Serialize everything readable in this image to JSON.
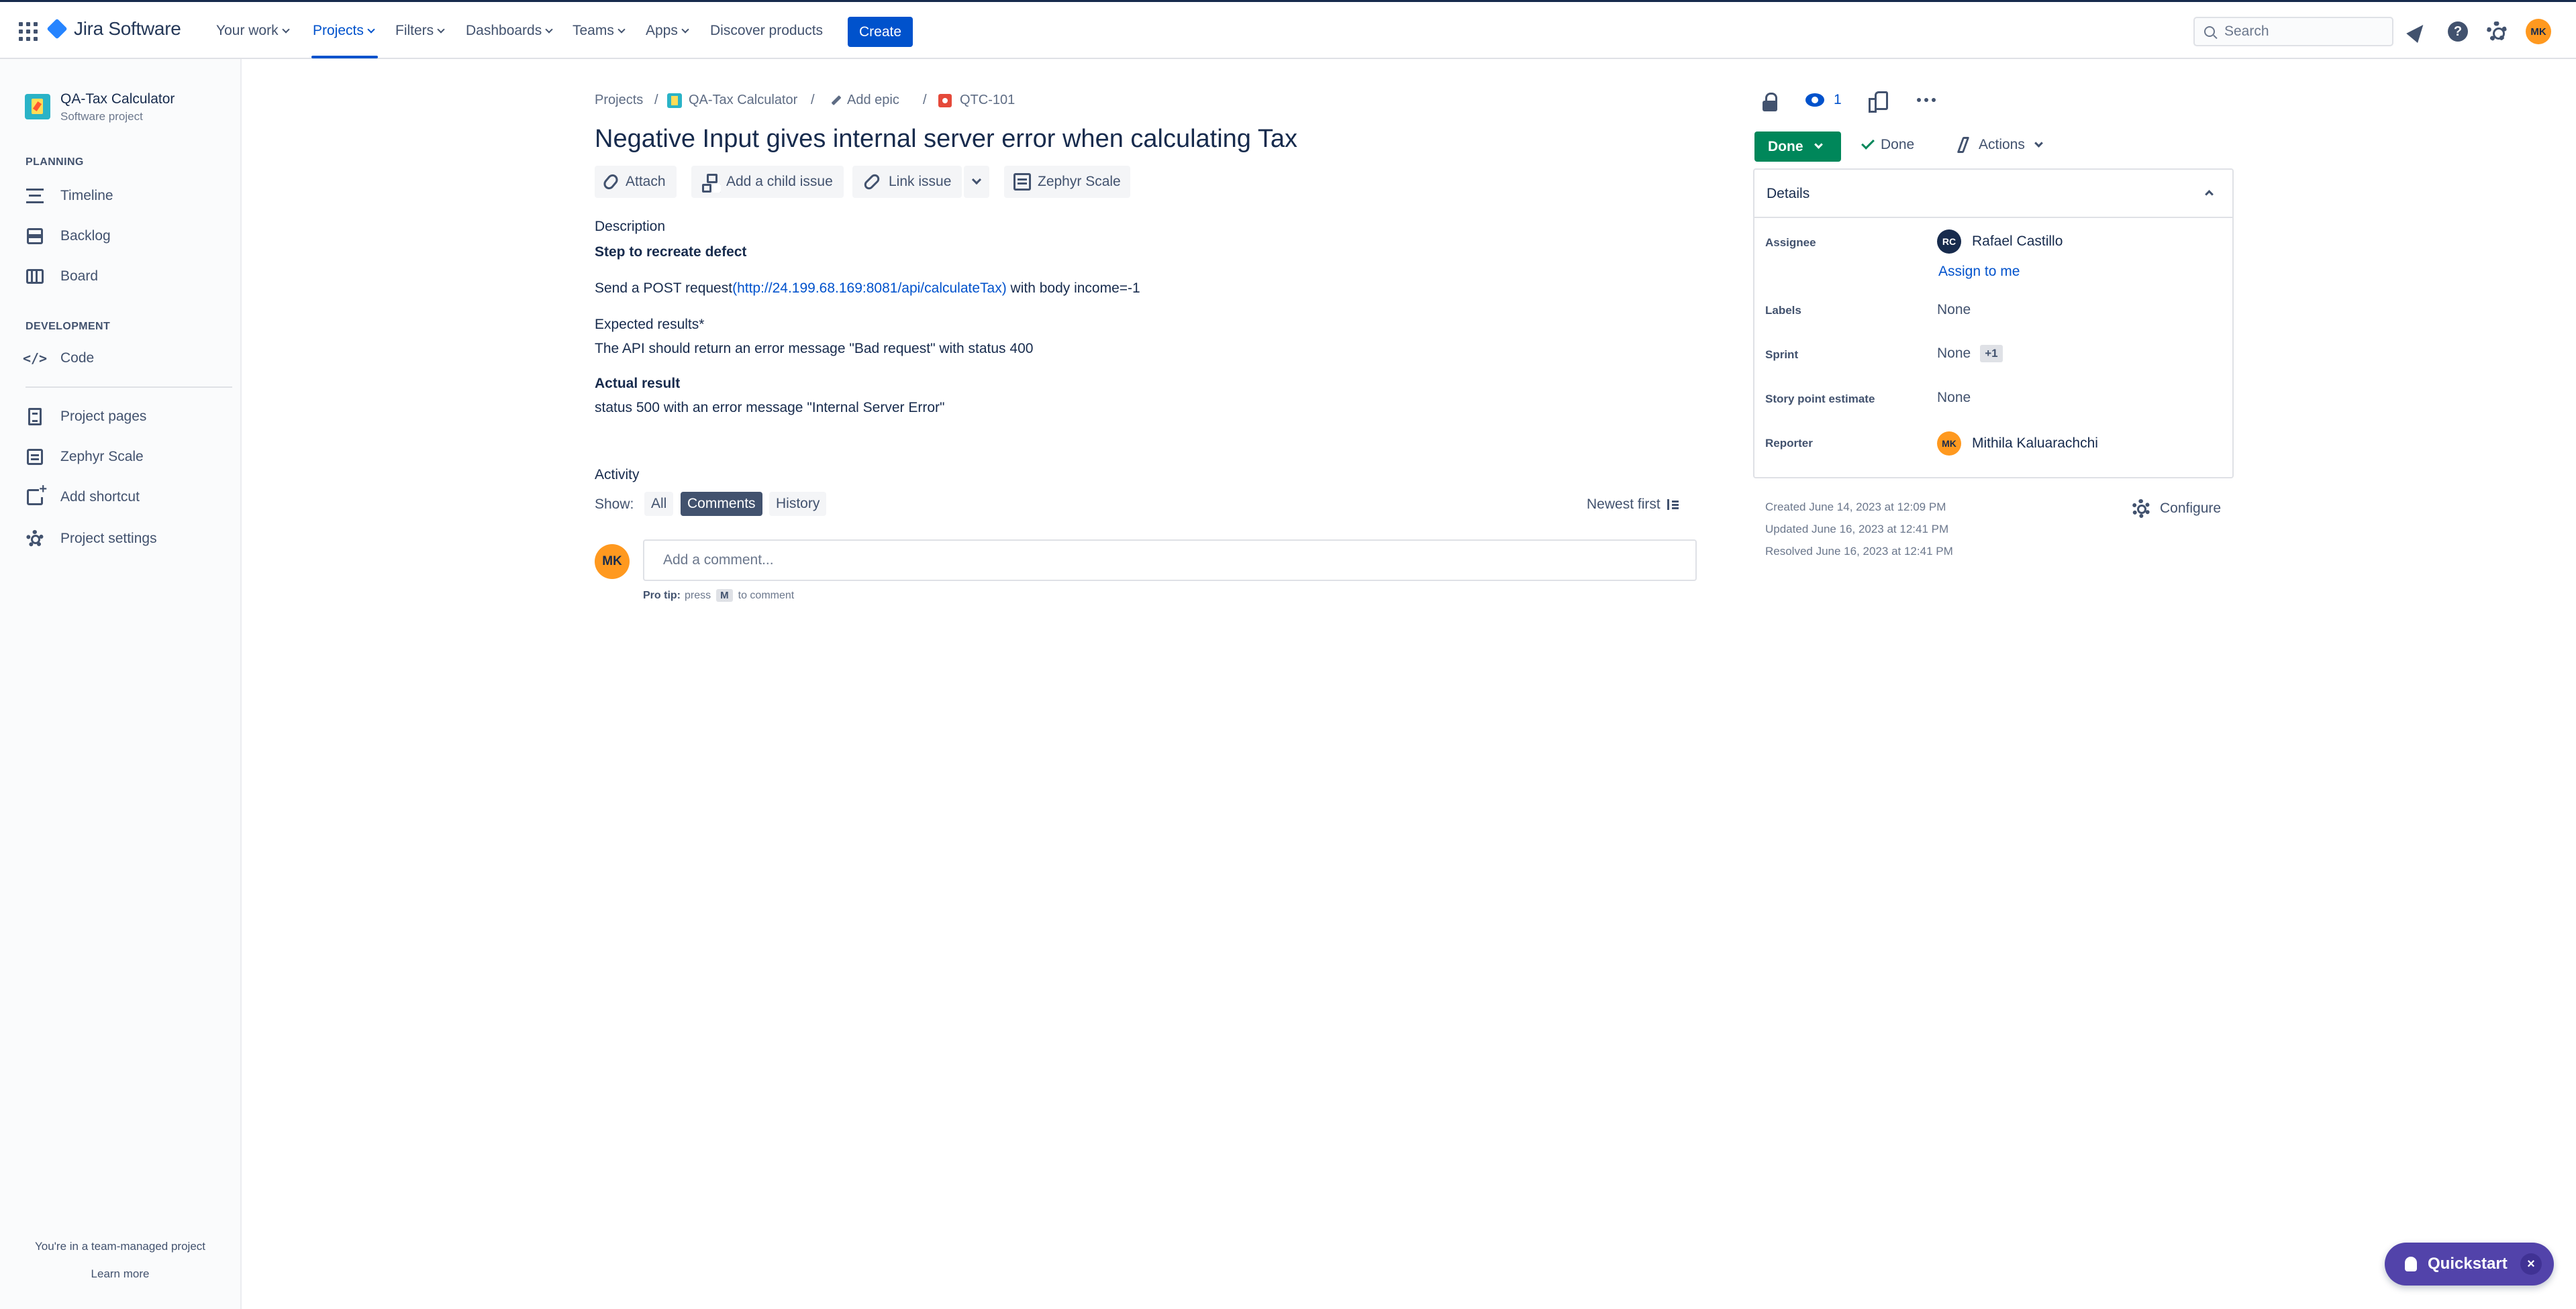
{
  "nav": {
    "logo": "Jira Software",
    "items": [
      "Your work",
      "Projects",
      "Filters",
      "Dashboards",
      "Teams",
      "Apps",
      "Discover products"
    ],
    "create_label": "Create",
    "search_placeholder": "Search",
    "user_initials": "MK"
  },
  "sidebar": {
    "project_name": "QA-Tax Calculator",
    "project_type": "Software project",
    "planning_title": "PLANNING",
    "planning_items": [
      "Timeline",
      "Backlog",
      "Board"
    ],
    "development_title": "DEVELOPMENT",
    "development_items": [
      "Code"
    ],
    "other_items": [
      "Project pages",
      "Zephyr Scale",
      "Add shortcut",
      "Project settings"
    ],
    "team_note": "You're in a team-managed project",
    "learn_more": "Learn more"
  },
  "breadcrumb": {
    "projects": "Projects",
    "separator": "/",
    "project": "QA-Tax Calculator",
    "epic": "Add epic",
    "issue_key": "QTC-101"
  },
  "issue": {
    "title": "Negative Input gives internal server error when calculating Tax",
    "toolbar": {
      "attach": "Attach",
      "child": "Add a child issue",
      "link": "Link issue",
      "zephyr": "Zephyr Scale"
    },
    "description_label": "Description",
    "step_heading": "Step to recreate defect",
    "step_prefix": "Send a POST request",
    "step_url": "(http://24.199.68.169:8081/api/calculateTax)",
    "step_suffix": " with body income=-1",
    "expected_heading": "Expected results*",
    "expected_text": "The API should return an error message \"Bad request\" with status 400",
    "actual_heading": "Actual result",
    "actual_text": "status 500 with an error message \"Internal Server Error\""
  },
  "activity": {
    "title": "Activity",
    "show_label": "Show:",
    "filters": [
      "All",
      "Comments",
      "History"
    ],
    "active_filter": "Comments",
    "sort_label": "Newest first",
    "user_initials": "MK",
    "comment_placeholder": "Add a comment...",
    "protip_label": "Pro tip:",
    "protip_press": "press",
    "protip_key": "M",
    "protip_suffix": "to comment"
  },
  "panel": {
    "watch_count": "1",
    "status_label": "Done",
    "resolution_label": "Done",
    "actions_label": "Actions",
    "details_title": "Details",
    "fields": {
      "assignee_label": "Assignee",
      "assignee_initials": "RC",
      "assignee_name": "Rafael Castillo",
      "assign_to_me": "Assign to me",
      "labels_label": "Labels",
      "labels_value": "None",
      "sprint_label": "Sprint",
      "sprint_value": "None",
      "sprint_extra": "+1",
      "story_points_label": "Story point estimate",
      "story_points_value": "None",
      "reporter_label": "Reporter",
      "reporter_initials": "MK",
      "reporter_name": "Mithila Kaluarachchi"
    },
    "created": "Created June 14, 2023 at 12:09 PM",
    "updated": "Updated June 16, 2023 at 12:41 PM",
    "resolved": "Resolved June 16, 2023 at 12:41 PM",
    "configure_label": "Configure"
  },
  "quickstart": {
    "label": "Quickstart",
    "close": "×"
  },
  "colors": {
    "brand_blue": "#0052cc",
    "done_green": "#00875a",
    "quickstart_purple": "#5243aa",
    "avatar_orange": "#ff991f"
  }
}
